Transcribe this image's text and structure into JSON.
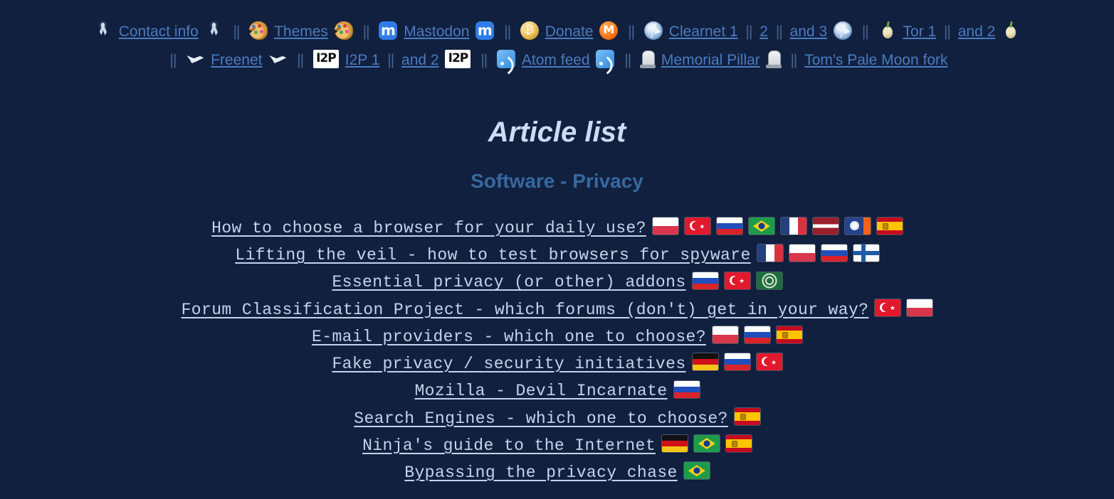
{
  "nav": {
    "line1": [
      {
        "type": "icon",
        "icon": "radio-tower-icon"
      },
      {
        "type": "link",
        "label": "Contact info"
      },
      {
        "type": "icon",
        "icon": "radio-tower-icon"
      },
      {
        "type": "sep",
        "label": "||"
      },
      {
        "type": "icon",
        "icon": "palette-icon"
      },
      {
        "type": "link",
        "label": "Themes"
      },
      {
        "type": "icon",
        "icon": "palette-icon"
      },
      {
        "type": "sep",
        "label": "||"
      },
      {
        "type": "icon",
        "icon": "mastodon-icon"
      },
      {
        "type": "link",
        "label": "Mastodon"
      },
      {
        "type": "icon",
        "icon": "mastodon-icon"
      },
      {
        "type": "sep",
        "label": "||"
      },
      {
        "type": "icon",
        "icon": "bitcoin-icon"
      },
      {
        "type": "link",
        "label": "Donate"
      },
      {
        "type": "icon",
        "icon": "monero-icon"
      },
      {
        "type": "sep",
        "label": "||"
      },
      {
        "type": "icon",
        "icon": "globe-icon"
      },
      {
        "type": "link",
        "label": "Clearnet 1"
      },
      {
        "type": "sep",
        "label": "||"
      },
      {
        "type": "link",
        "label": "2"
      },
      {
        "type": "sep",
        "label": "||"
      },
      {
        "type": "link",
        "label": "and 3"
      },
      {
        "type": "icon",
        "icon": "globe-icon"
      },
      {
        "type": "sep",
        "label": "||"
      },
      {
        "type": "icon",
        "icon": "onion-icon"
      },
      {
        "type": "link",
        "label": "Tor 1"
      },
      {
        "type": "sep",
        "label": "||"
      },
      {
        "type": "link",
        "label": "and 2"
      },
      {
        "type": "icon",
        "icon": "onion-icon"
      }
    ],
    "line2": [
      {
        "type": "sep",
        "label": "||"
      },
      {
        "type": "icon",
        "icon": "freenet-bird-icon"
      },
      {
        "type": "link",
        "label": "Freenet"
      },
      {
        "type": "icon",
        "icon": "freenet-bird-icon"
      },
      {
        "type": "sep",
        "label": "||"
      },
      {
        "type": "icon",
        "icon": "i2p-icon"
      },
      {
        "type": "link",
        "label": "I2P 1"
      },
      {
        "type": "sep",
        "label": "||"
      },
      {
        "type": "link",
        "label": "and 2"
      },
      {
        "type": "icon",
        "icon": "i2p-icon"
      },
      {
        "type": "sep",
        "label": "||"
      },
      {
        "type": "icon",
        "icon": "rss-icon"
      },
      {
        "type": "link",
        "label": "Atom feed"
      },
      {
        "type": "icon",
        "icon": "rss-icon"
      },
      {
        "type": "sep",
        "label": "||"
      },
      {
        "type": "icon",
        "icon": "memorial-pillar-icon"
      },
      {
        "type": "link",
        "label": "Memorial Pillar"
      },
      {
        "type": "icon",
        "icon": "memorial-pillar-icon"
      },
      {
        "type": "sep",
        "label": "||"
      },
      {
        "type": "link",
        "label": "Tom's Pale Moon fork"
      }
    ]
  },
  "page_title": "Article list",
  "section_title": "Software - Privacy",
  "articles": [
    {
      "title": "How to choose a browser for your daily use?",
      "flags": [
        "pl",
        "tr",
        "ru",
        "br",
        "fr",
        "lv",
        "mm",
        "es"
      ]
    },
    {
      "title": "Lifting the veil - how to test browsers for spyware",
      "flags": [
        "fr",
        "pl",
        "ru",
        "fi"
      ]
    },
    {
      "title": "Essential privacy (or other) addons",
      "flags": [
        "ru",
        "tr",
        "al"
      ]
    },
    {
      "title": "Forum Classification Project - which forums (don't) get in your way?",
      "flags": [
        "tr",
        "pl"
      ]
    },
    {
      "title": "E-mail providers - which one to choose?",
      "flags": [
        "pl",
        "ru",
        "es"
      ]
    },
    {
      "title": "Fake privacy / security initiatives",
      "flags": [
        "de",
        "ru",
        "tr"
      ]
    },
    {
      "title": "Mozilla - Devil Incarnate",
      "flags": [
        "ru"
      ]
    },
    {
      "title": "Search Engines - which one to choose?",
      "flags": [
        "es"
      ]
    },
    {
      "title": "Ninja's guide to the Internet",
      "flags": [
        "de",
        "br",
        "es"
      ]
    },
    {
      "title": "Bypassing the privacy chase",
      "flags": [
        "br"
      ]
    }
  ],
  "flag_names": {
    "pl": "flag-poland",
    "tr": "flag-turkey",
    "ru": "flag-russia",
    "br": "flag-brazil",
    "fr": "flag-france",
    "lv": "flag-latvia",
    "mm": "flag-myanmar",
    "es": "flag-spain",
    "fi": "flag-finland",
    "de": "flag-germany",
    "al": "flag-arab-league"
  },
  "colors": {
    "background": "#11203f",
    "link": "#4b7bbf",
    "article_link": "#c5d4ec",
    "title": "#cddcf5",
    "section_title": "#36699f"
  }
}
